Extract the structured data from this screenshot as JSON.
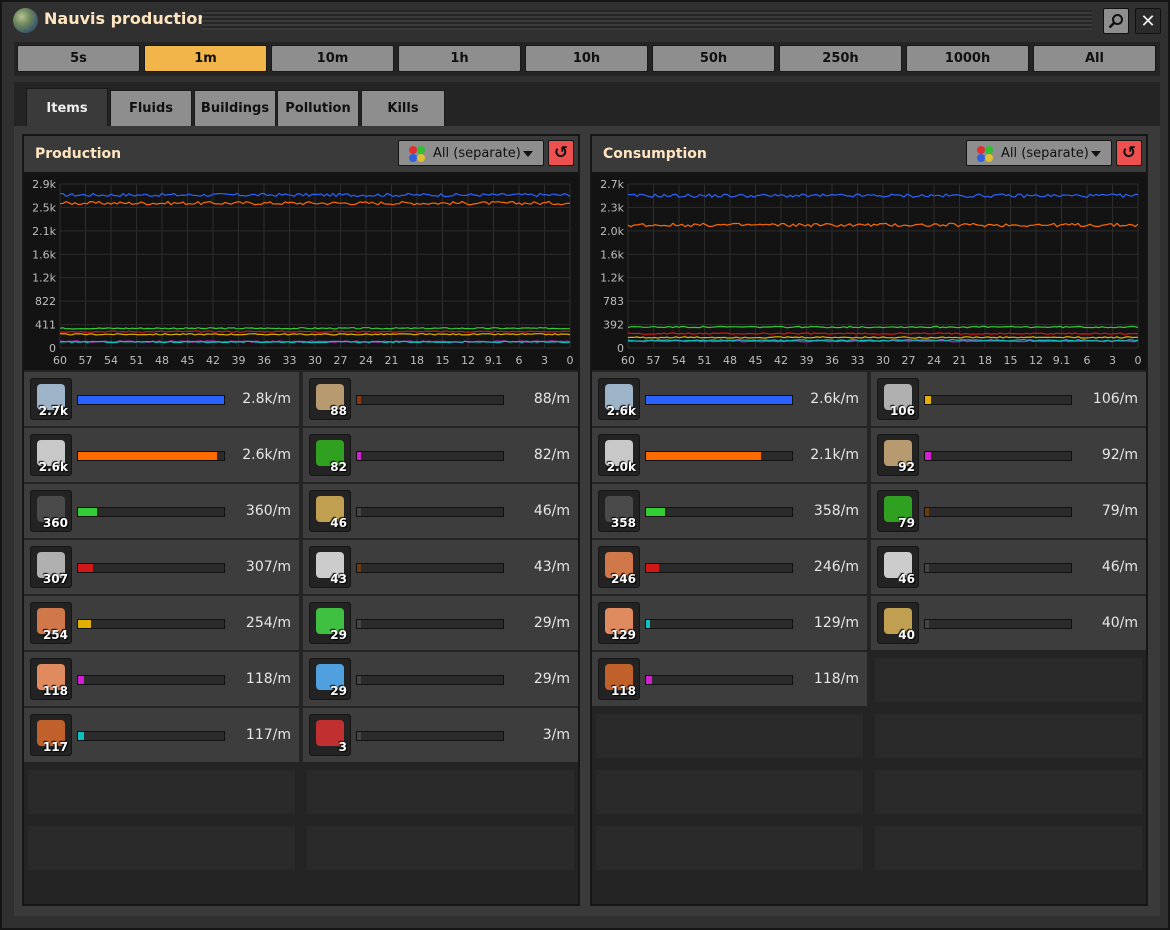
{
  "window": {
    "title": "Nauvis production"
  },
  "time_ranges": [
    {
      "label": "5s",
      "active": false
    },
    {
      "label": "1m",
      "active": true
    },
    {
      "label": "10m",
      "active": false
    },
    {
      "label": "1h",
      "active": false
    },
    {
      "label": "10h",
      "active": false
    },
    {
      "label": "50h",
      "active": false
    },
    {
      "label": "250h",
      "active": false
    },
    {
      "label": "1000h",
      "active": false
    },
    {
      "label": "All",
      "active": false
    }
  ],
  "tabs": [
    {
      "label": "Items",
      "active": true
    },
    {
      "label": "Fluids",
      "active": false
    },
    {
      "label": "Buildings",
      "active": false
    },
    {
      "label": "Pollution",
      "active": false
    },
    {
      "label": "Kills",
      "active": false
    }
  ],
  "colors": {
    "blue": "#2a63ff",
    "orange": "#ff6a00",
    "green": "#33cc33",
    "red": "#d01818",
    "yellow": "#e0b000",
    "magenta": "#d020d0",
    "cyan": "#10c0c0",
    "dim": "#6b3a10"
  },
  "production": {
    "title": "Production",
    "filter_label": "All (separate)",
    "chart_data": {
      "type": "line",
      "y_ticks": [
        "2.9k",
        "2.5k",
        "2.1k",
        "1.6k",
        "1.2k",
        "822",
        "411",
        "0"
      ],
      "x_ticks": [
        "60",
        "57",
        "54",
        "51",
        "48",
        "45",
        "42",
        "39",
        "36",
        "33",
        "30",
        "27",
        "24",
        "21",
        "18",
        "15",
        "12",
        "9.1",
        "6",
        "3",
        "0"
      ],
      "ylim": [
        0,
        3000
      ],
      "series": [
        {
          "color": "#2a63ff",
          "level": 2800
        },
        {
          "color": "#ff6a00",
          "level": 2650
        },
        {
          "color": "#33cc33",
          "level": 360
        },
        {
          "color": "#d01818",
          "level": 300
        },
        {
          "color": "#e0b000",
          "level": 250
        },
        {
          "color": "#d020d0",
          "level": 118
        },
        {
          "color": "#10c0c0",
          "level": 110
        }
      ]
    },
    "left_items": [
      {
        "count": "2.7k",
        "rate": "2.8k/m",
        "fill": 1.0,
        "color": "#2a63ff",
        "icon": "iron-ore-icon",
        "glyph": "#9db3c8"
      },
      {
        "count": "2.6k",
        "rate": "2.6k/m",
        "fill": 0.95,
        "color": "#ff6a00",
        "icon": "stone-icon",
        "glyph": "#c8c8c8"
      },
      {
        "count": "360",
        "rate": "360/m",
        "fill": 0.13,
        "color": "#33cc33",
        "icon": "coal-icon",
        "glyph": "#4a4a4a"
      },
      {
        "count": "307",
        "rate": "307/m",
        "fill": 0.1,
        "color": "#d01818",
        "icon": "iron-stick-icon",
        "glyph": "#b0b0b0"
      },
      {
        "count": "254",
        "rate": "254/m",
        "fill": 0.09,
        "color": "#e0b000",
        "icon": "copper-cable-icon",
        "glyph": "#d0784a"
      },
      {
        "count": "118",
        "rate": "118/m",
        "fill": 0.04,
        "color": "#d020d0",
        "icon": "copper-plate-icon",
        "glyph": "#e08a60"
      },
      {
        "count": "117",
        "rate": "117/m",
        "fill": 0.04,
        "color": "#10c0c0",
        "icon": "copper-ore-icon",
        "glyph": "#c0602a"
      }
    ],
    "right_items": [
      {
        "count": "88",
        "rate": "88/m",
        "fill": 0.03,
        "color": "#8a3a10",
        "icon": "iron-gear-icon",
        "glyph": "#b89a70"
      },
      {
        "count": "82",
        "rate": "82/m",
        "fill": 0.03,
        "color": "#d020d0",
        "icon": "electronic-circuit-icon",
        "glyph": "#30a020"
      },
      {
        "count": "46",
        "rate": "46/m",
        "fill": 0.01,
        "color": "#444444",
        "icon": "inserter-icon",
        "glyph": "#c0a050"
      },
      {
        "count": "43",
        "rate": "43/m",
        "fill": 0.01,
        "color": "#6b3a10",
        "icon": "gear-icon",
        "glyph": "#cccccc"
      },
      {
        "count": "29",
        "rate": "29/m",
        "fill": 0.01,
        "color": "#444444",
        "icon": "science-pack-icon",
        "glyph": "#40c040"
      },
      {
        "count": "29",
        "rate": "29/m",
        "fill": 0.01,
        "color": "#444444",
        "icon": "lab-icon",
        "glyph": "#50a0e0"
      },
      {
        "count": "3",
        "rate": "3/m",
        "fill": 0.0,
        "color": "#444444",
        "icon": "car-icon",
        "glyph": "#c03030"
      }
    ]
  },
  "consumption": {
    "title": "Consumption",
    "filter_label": "All (separate)",
    "chart_data": {
      "type": "line",
      "y_ticks": [
        "2.7k",
        "2.3k",
        "2.0k",
        "1.6k",
        "1.2k",
        "783",
        "392",
        "0"
      ],
      "x_ticks": [
        "60",
        "57",
        "54",
        "51",
        "48",
        "45",
        "42",
        "39",
        "36",
        "33",
        "30",
        "27",
        "24",
        "21",
        "18",
        "15",
        "12",
        "9.1",
        "6",
        "3",
        "0"
      ],
      "ylim": [
        0,
        2800
      ],
      "series": [
        {
          "color": "#2a63ff",
          "level": 2600
        },
        {
          "color": "#ff6a00",
          "level": 2100
        },
        {
          "color": "#33cc33",
          "level": 358
        },
        {
          "color": "#d01818",
          "level": 246
        },
        {
          "color": "#e0b000",
          "level": 180
        },
        {
          "color": "#d020d0",
          "level": 118
        },
        {
          "color": "#10c0c0",
          "level": 129
        }
      ]
    },
    "left_items": [
      {
        "count": "2.6k",
        "rate": "2.6k/m",
        "fill": 1.0,
        "color": "#2a63ff",
        "icon": "iron-ore-icon",
        "glyph": "#9db3c8"
      },
      {
        "count": "2.0k",
        "rate": "2.1k/m",
        "fill": 0.79,
        "color": "#ff6a00",
        "icon": "stone-icon",
        "glyph": "#c8c8c8"
      },
      {
        "count": "358",
        "rate": "358/m",
        "fill": 0.13,
        "color": "#33cc33",
        "icon": "coal-icon",
        "glyph": "#4a4a4a"
      },
      {
        "count": "246",
        "rate": "246/m",
        "fill": 0.09,
        "color": "#d01818",
        "icon": "copper-cable-icon",
        "glyph": "#d0784a"
      },
      {
        "count": "129",
        "rate": "129/m",
        "fill": 0.03,
        "color": "#10c0c0",
        "icon": "copper-plate-icon",
        "glyph": "#e08a60"
      },
      {
        "count": "118",
        "rate": "118/m",
        "fill": 0.04,
        "color": "#d020d0",
        "icon": "copper-ore-icon",
        "glyph": "#c0602a"
      }
    ],
    "right_items": [
      {
        "count": "106",
        "rate": "106/m",
        "fill": 0.04,
        "color": "#e0b000",
        "icon": "iron-stick-icon",
        "glyph": "#b0b0b0"
      },
      {
        "count": "92",
        "rate": "92/m",
        "fill": 0.04,
        "color": "#d020d0",
        "icon": "iron-gear-icon",
        "glyph": "#b89a70"
      },
      {
        "count": "79",
        "rate": "79/m",
        "fill": 0.01,
        "color": "#6b3a10",
        "icon": "electronic-circuit-icon",
        "glyph": "#30a020"
      },
      {
        "count": "46",
        "rate": "46/m",
        "fill": 0.01,
        "color": "#444444",
        "icon": "gear-icon",
        "glyph": "#cccccc"
      },
      {
        "count": "40",
        "rate": "40/m",
        "fill": 0.0,
        "color": "#444444",
        "icon": "inserter-icon",
        "glyph": "#c0a050"
      }
    ]
  }
}
